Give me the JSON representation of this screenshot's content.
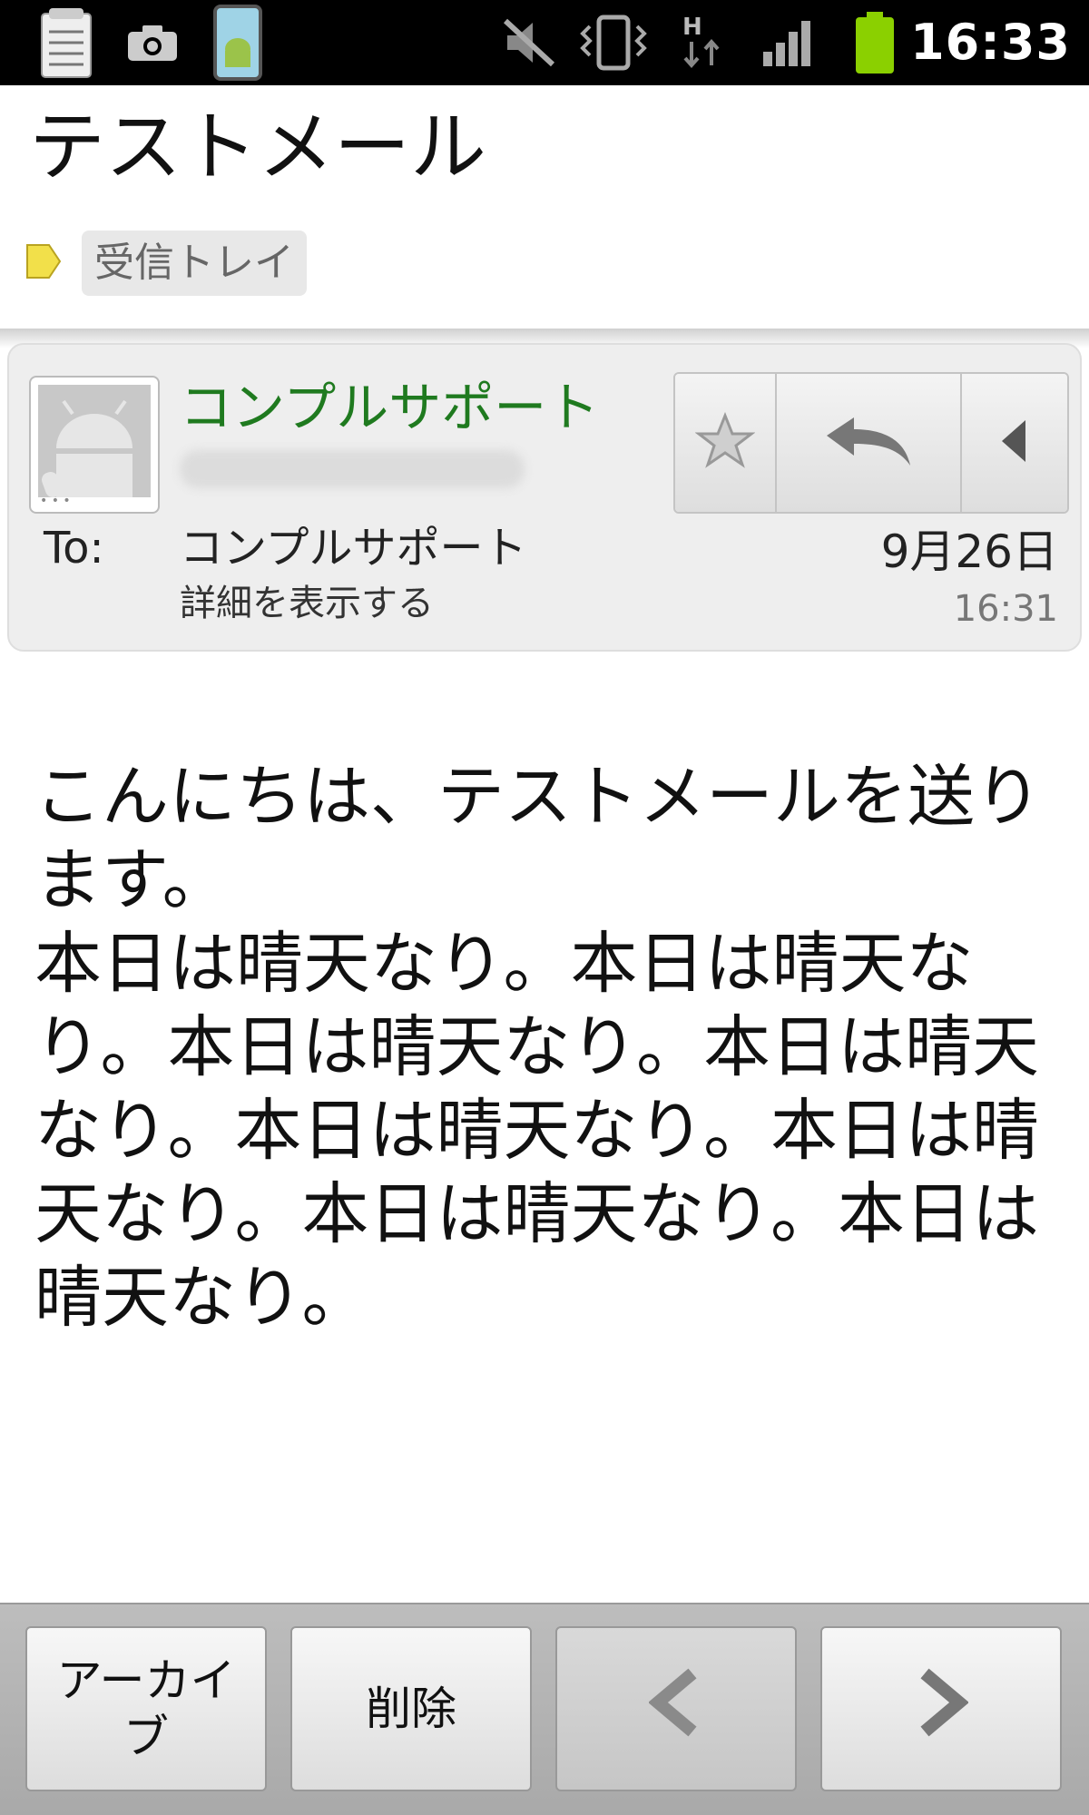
{
  "status_bar": {
    "time": "16:33",
    "icons": [
      "notepad-icon",
      "camera-icon",
      "android-app-icon",
      "mute-icon",
      "vibrate-icon",
      "data-h-arrows-icon",
      "signal-icon",
      "battery-icon"
    ],
    "battery_color": "#8bd000"
  },
  "message": {
    "subject": "テストメール",
    "label": "受信トレイ",
    "label_tag_color": "#f2e04a",
    "sender": {
      "name": "コンプルサポート",
      "name_color": "#1f7a1f"
    },
    "to_label": "To:",
    "to_name": "コンプルサポート",
    "details_link": "詳細を表示する",
    "date": "9月26日",
    "time": "16:31",
    "body": "こんにちは、テストメールを送ります。\n本日は晴天なり。本日は晴天なり。本日は晴天なり。本日は晴天なり。本日は晴天なり。本日は晴天なり。本日は晴天なり。本日は晴天なり。"
  },
  "header_actions": [
    "star-icon",
    "reply-icon",
    "expand-left-icon"
  ],
  "bottom_bar": {
    "archive_label": "アーカイブ",
    "delete_label": "削除",
    "prev_icon": "chevron-left-icon",
    "next_icon": "chevron-right-icon"
  }
}
